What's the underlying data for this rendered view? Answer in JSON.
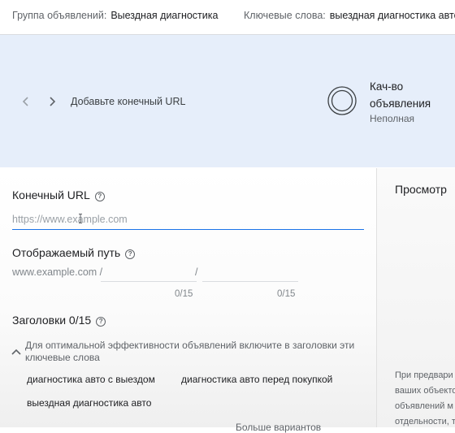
{
  "header": {
    "ad_group_label": "Группа объявлений:",
    "ad_group_value": "Выездная диагностика",
    "keywords_label": "Ключевые слова:",
    "keywords_value": "выездная диагностика авто, ..."
  },
  "banner": {
    "prev_icon": "chevron-left-icon",
    "next_icon": "chevron-right-icon",
    "text": "Добавьте конечный URL",
    "quality_title": "Кач-во объявления",
    "quality_status": "Неполная"
  },
  "form": {
    "final_url": {
      "label": "Конечный URL",
      "placeholder": "https://www.example.com",
      "value": ""
    },
    "display_path": {
      "label": "Отображаемый путь",
      "prefix": "www.example.com /",
      "separator": "/",
      "path1_counter": "0/15",
      "path2_counter": "0/15"
    },
    "headlines": {
      "label": "Заголовки 0/15",
      "tip": "Для оптимальной эффективности объявлений включите в заголовки эти ключевые слова",
      "keywords": [
        "диагностика авто с выездом",
        "диагностика авто перед покупкой",
        "выездная диагностика авто"
      ],
      "more_link": "Больше вариантов"
    }
  },
  "preview": {
    "title": "Просмотр",
    "note_lines": [
      "При предвари",
      "ваших объекто",
      "объявлений м",
      "отдельности, т"
    ]
  },
  "colors": {
    "banner_bg": "#e6eefa",
    "accent": "#1a73e8"
  }
}
